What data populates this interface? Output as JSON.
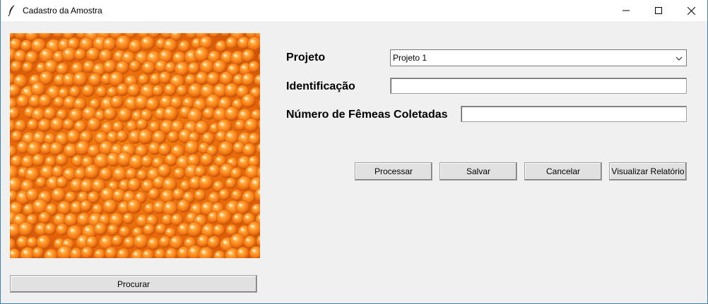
{
  "window": {
    "title": "Cadastro da Amostra",
    "controls": {
      "minimize_icon": "minimize-icon",
      "maximize_icon": "maximize-icon",
      "close_icon": "close-icon"
    }
  },
  "image_panel": {
    "description_icon": "sample-photo",
    "browse_label": "Procurar"
  },
  "form": {
    "projeto": {
      "label": "Projeto",
      "selected": "Projeto 1"
    },
    "identificacao": {
      "label": "Identificação",
      "value": ""
    },
    "femeas": {
      "label": "Número de Fêmeas Coletadas",
      "value": ""
    }
  },
  "actions": {
    "processar": "Processar",
    "salvar": "Salvar",
    "cancelar": "Cancelar",
    "relatorio": "Visualizar Relatório"
  },
  "colors": {
    "background": "#f0f0f0",
    "titlebar": "#ffffff",
    "button_face": "#e1e1e1",
    "window_border": "#3c7fb1",
    "roe_orange": "#f47a16"
  }
}
